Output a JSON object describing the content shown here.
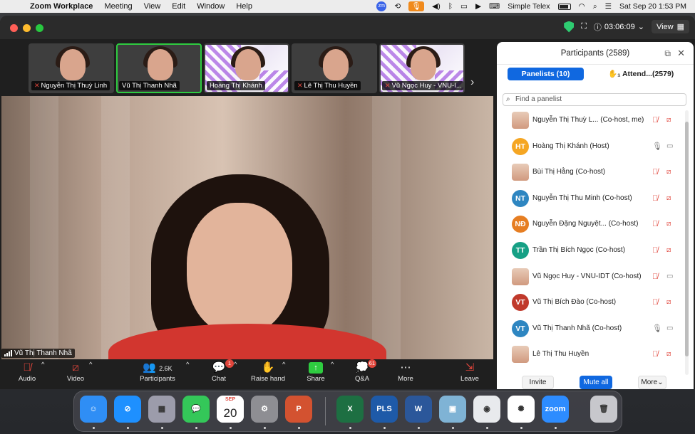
{
  "menubar": {
    "app_name": "Zoom Workplace",
    "menus": [
      "Meeting",
      "View",
      "Edit",
      "Window",
      "Help"
    ],
    "status_text": "Simple Telex",
    "clock": "Sat Sep 20  1:53 PM"
  },
  "titlebar": {
    "timer": "03:06:09",
    "view_label": "View"
  },
  "thumbnails": [
    {
      "name": "Nguyễn Thị Thuỳ Linh",
      "muted": true,
      "kind": "person"
    },
    {
      "name": "Vũ Thị Thanh Nhã",
      "muted": false,
      "kind": "person",
      "active": true
    },
    {
      "name": "Hoàng Thị Khánh",
      "muted": false,
      "kind": "banner"
    },
    {
      "name": "Lê Thị Thu Huyền",
      "muted": true,
      "kind": "person"
    },
    {
      "name": "Vũ Ngọc Huy - VNU-I...",
      "muted": true,
      "kind": "banner"
    }
  ],
  "main_video": {
    "speaker_name": "Vũ Thị Thanh Nhã"
  },
  "toolbar": {
    "audio_label": "Audio",
    "video_label": "Video",
    "participants_label": "Participants",
    "participants_count": "2.6K",
    "chat_label": "Chat",
    "chat_badge": "1",
    "raise_hand_label": "Raise hand",
    "share_label": "Share",
    "qa_label": "Q&A",
    "qa_badge": "61",
    "more_label": "More",
    "leave_label": "Leave"
  },
  "panel": {
    "title": "Participants (2589)",
    "tab_panelists": "Panelists (10)",
    "tab_attendees": "Attend...(2579)",
    "search_placeholder": "Find a panelist",
    "participants": [
      {
        "name": "Nguyễn Thị Thuỳ L...  (Co-host, me)",
        "initials": "",
        "color": "",
        "photo": true,
        "mic_on": false,
        "cam_on": false
      },
      {
        "name": "Hoàng Thị Khánh (Host)",
        "initials": "HT",
        "color": "#f5a623",
        "photo": false,
        "mic_on": true,
        "cam_on": true
      },
      {
        "name": "Bùi Thị Hằng (Co-host)",
        "initials": "",
        "color": "",
        "photo": true,
        "mic_on": false,
        "cam_on": false
      },
      {
        "name": "Nguyễn Thị Thu Minh (Co-host)",
        "initials": "NT",
        "color": "#2e86c1",
        "photo": false,
        "mic_on": false,
        "cam_on": false
      },
      {
        "name": "Nguyễn Đặng Nguyệt...      (Co-host)",
        "initials": "NĐ",
        "color": "#e67e22",
        "photo": false,
        "mic_on": false,
        "cam_on": false
      },
      {
        "name": "Trần Thị Bích Ngọc (Co-host)",
        "initials": "TT",
        "color": "#16a085",
        "photo": false,
        "mic_on": false,
        "cam_on": false
      },
      {
        "name": "Vũ Ngọc Huy - VNU-IDT (Co-host)",
        "initials": "",
        "color": "",
        "photo": true,
        "mic_on": false,
        "cam_on": true
      },
      {
        "name": "Vũ Thị Bích Đào (Co-host)",
        "initials": "VT",
        "color": "#c0392b",
        "photo": false,
        "mic_on": false,
        "cam_on": false
      },
      {
        "name": "Vũ Thị Thanh Nhã (Co-host)",
        "initials": "VT",
        "color": "#2e86c1",
        "photo": false,
        "mic_on": true,
        "cam_on": true
      },
      {
        "name": "Lê Thị Thu Huyền",
        "initials": "",
        "color": "",
        "photo": true,
        "mic_on": false,
        "cam_on": false
      }
    ],
    "invite_label": "Invite",
    "mute_all_label": "Mute all",
    "more_label": "More"
  },
  "dock": {
    "calendar_month": "SEP",
    "calendar_day": "20",
    "apps": [
      {
        "name": "Finder",
        "color": "#2f8ef5",
        "glyph": "☺"
      },
      {
        "name": "Safari",
        "color": "#1e90ff",
        "glyph": "⊘"
      },
      {
        "name": "Launchpad",
        "color": "#9c9cab",
        "glyph": "▦"
      },
      {
        "name": "Messages",
        "color": "#34c759",
        "glyph": "💬"
      },
      {
        "name": "Calendar",
        "color": "#ffffff",
        "glyph": ""
      },
      {
        "name": "System Settings",
        "color": "#8e8e93",
        "glyph": "⚙"
      },
      {
        "name": "PowerPoint",
        "color": "#d35230",
        "glyph": "P"
      },
      {
        "name": "Excel",
        "color": "#1d6f42",
        "glyph": "X"
      },
      {
        "name": "PLS",
        "color": "#1e5aa8",
        "glyph": "PLS"
      },
      {
        "name": "Word",
        "color": "#2b579a",
        "glyph": "W"
      },
      {
        "name": "Preview",
        "color": "#7fb3d5",
        "glyph": "▣"
      },
      {
        "name": "Chrome",
        "color": "#e8eaed",
        "glyph": "◉"
      },
      {
        "name": "ChatGPT",
        "color": "#ffffff",
        "glyph": "✺"
      },
      {
        "name": "Zoom",
        "color": "#2d8cff",
        "glyph": "zoom"
      },
      {
        "name": "Trash",
        "color": "#c7c7cc",
        "glyph": "🗑"
      }
    ]
  }
}
